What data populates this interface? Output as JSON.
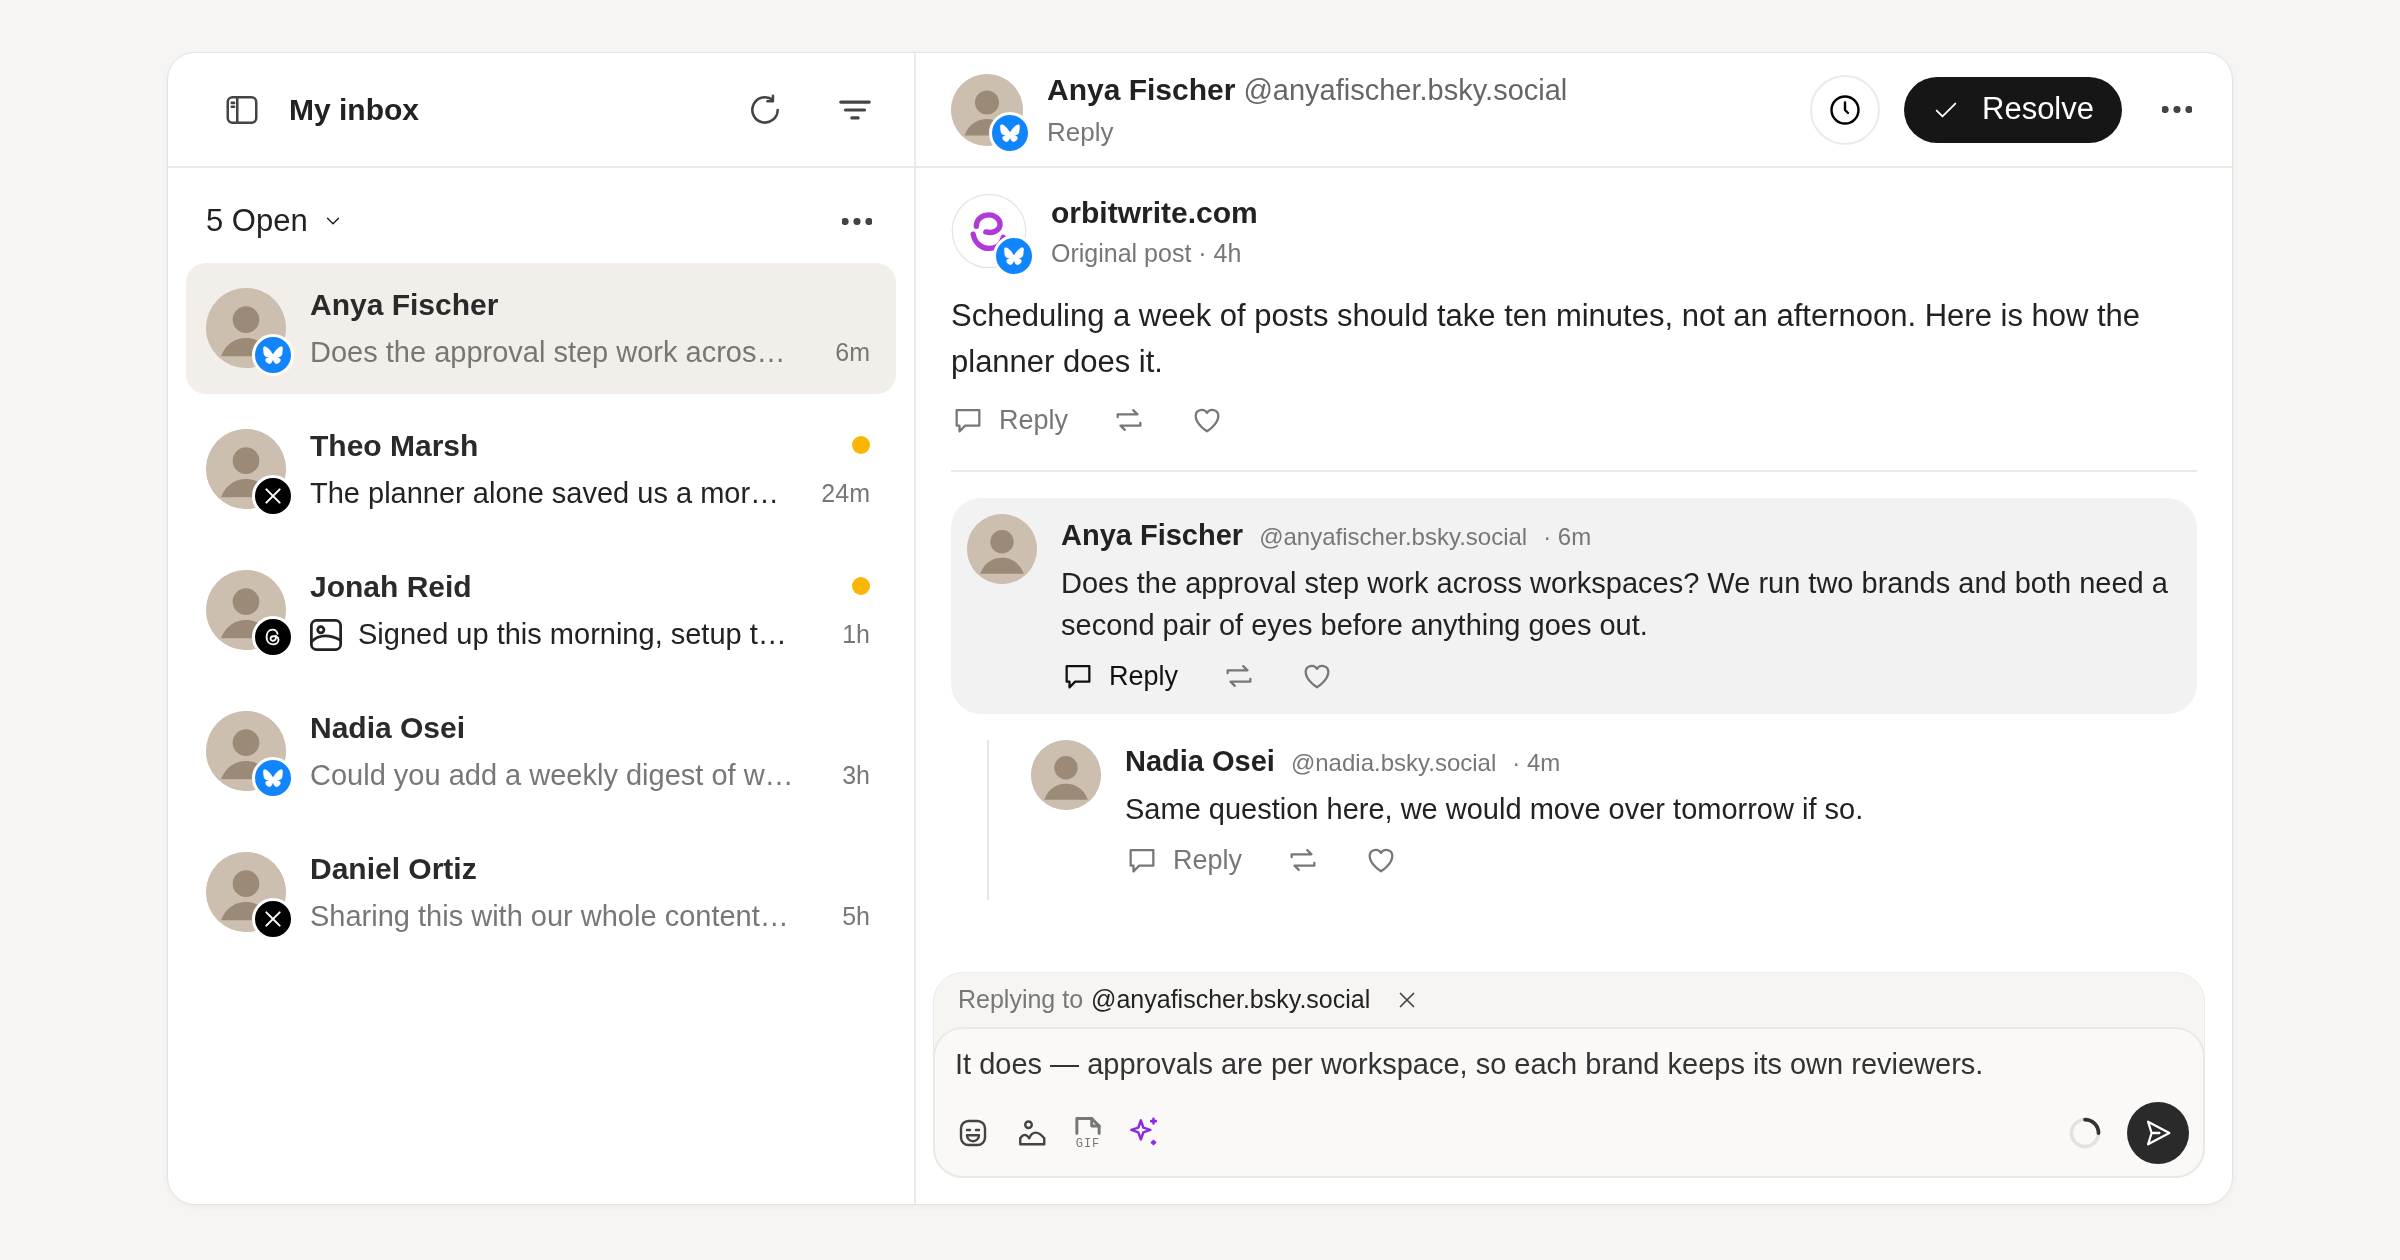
{
  "sidebar": {
    "title": "My inbox",
    "filter": {
      "label": "5 Open"
    },
    "conversations": [
      {
        "name": "Anya Fischer",
        "preview": "Does the approval step work acros…",
        "time": "6m",
        "kind": "bluesky",
        "selected": true,
        "unread": false,
        "has_image": false
      },
      {
        "name": "Theo Marsh",
        "preview": "The planner alone saved us a mor…",
        "time": "24m",
        "kind": "x",
        "selected": false,
        "unread": true,
        "has_image": false
      },
      {
        "name": "Jonah Reid",
        "preview": "Signed up this morning, setup t…",
        "time": "1h",
        "kind": "threads",
        "selected": false,
        "unread": true,
        "has_image": true
      },
      {
        "name": "Nadia Osei",
        "preview": "Could you add a weekly digest of w…",
        "time": "3h",
        "kind": "bluesky",
        "selected": false,
        "unread": false,
        "has_image": false
      },
      {
        "name": "Daniel Ortiz",
        "preview": "Sharing this with our whole content…",
        "time": "5h",
        "kind": "x",
        "selected": false,
        "unread": false,
        "has_image": false
      }
    ]
  },
  "conversation": {
    "name": "Anya Fischer",
    "handle": "@anyafischer.bsky.social",
    "subtitle": "Reply",
    "kind": "bluesky",
    "resolve_label": "Resolve"
  },
  "post": {
    "author": "orbitwrite.com",
    "meta": "Original post · 4h",
    "kind": "bluesky",
    "text": "Scheduling a week of posts should take ten minutes, not an afternoon. Here is how the planner does it.",
    "reply_label": "Reply"
  },
  "replies": [
    {
      "name": "Anya Fischer",
      "handle": "@anyafischer.bsky.social",
      "time": "· 6m",
      "text": "Does the approval step work across workspaces? We run two brands and both need a second pair of eyes before anything goes out.",
      "reply_label": "Reply",
      "highlighted": true,
      "children": [
        {
          "name": "Nadia Osei",
          "handle": "@nadia.bsky.social",
          "time": "· 4m",
          "text": "Same question here, we would move over tomorrow if so.",
          "reply_label": "Reply",
          "highlighted": false
        }
      ]
    }
  ],
  "composer": {
    "replying_label": "Replying to",
    "replying_handle": "@anyafischer.bsky.social",
    "value": "It does — approvals are per workspace, so each brand keeps its own reviewers.",
    "gif_label": "GIF"
  }
}
